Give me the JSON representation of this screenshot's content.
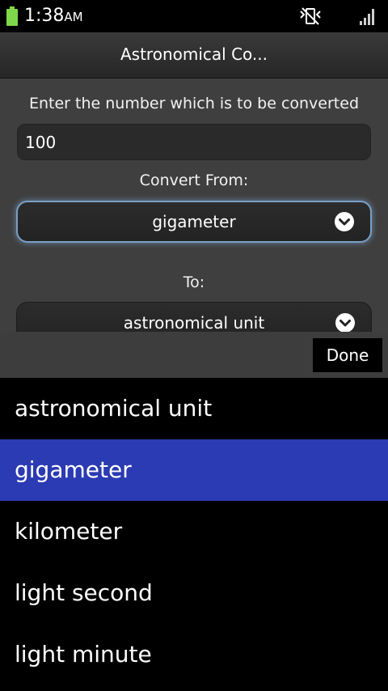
{
  "status_bar": {
    "time": "1:38",
    "ampm": "AM",
    "icons": [
      "battery-icon",
      "vibrate-icon",
      "signal-icon"
    ]
  },
  "title": "Astronomical Co...",
  "form": {
    "number_label": "Enter the number which is to be converted",
    "number_value": "100",
    "from_label": "Convert From:",
    "from_value": "gigameter",
    "to_label": "To:",
    "to_value": "astronomical unit"
  },
  "picker": {
    "done_label": "Done",
    "options": [
      {
        "label": "astronomical unit",
        "selected": false
      },
      {
        "label": "gigameter",
        "selected": true
      },
      {
        "label": "kilometer",
        "selected": false
      },
      {
        "label": "light second",
        "selected": false
      },
      {
        "label": "light minute",
        "selected": false
      }
    ],
    "selected_color": "#2b3bb3"
  },
  "colors": {
    "battery": "#7fd84a",
    "focus_glow": "#7aa0c4"
  }
}
